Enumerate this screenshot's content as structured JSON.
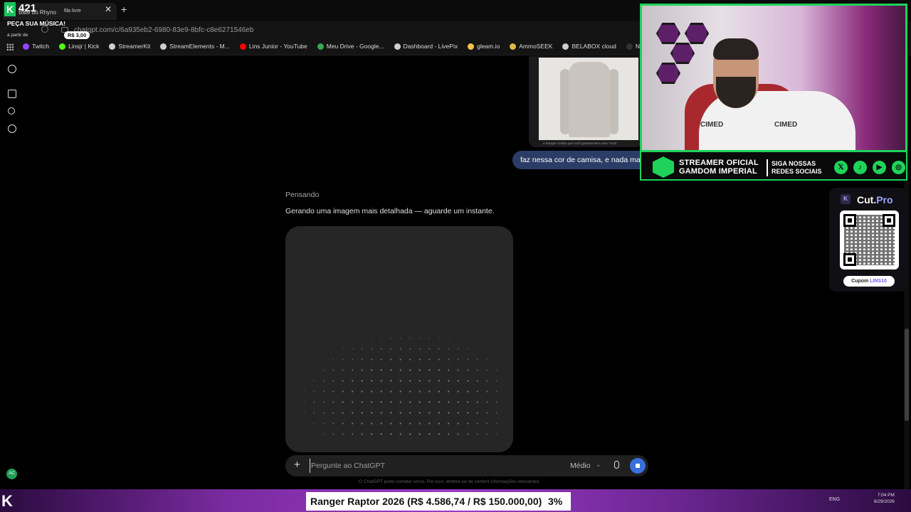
{
  "browser": {
    "tabs": [
      {
        "title": "Bate do Rhyno"
      },
      {
        "title": "fila livre"
      }
    ],
    "url": "chatgpt.com/c/6a935eb2-6980-83e9-8bfc-c8e6271546eb",
    "bookmarks": [
      {
        "label": "Twitch",
        "color": "#9146ff"
      },
      {
        "label": "Linsjr | Kick",
        "color": "#53fc18"
      },
      {
        "label": "StreamerKit",
        "color": "#cfcfcf"
      },
      {
        "label": "StreamElements - M...",
        "color": "#cfcfcf"
      },
      {
        "label": "Lins Junior - YouTube",
        "color": "#ff0000"
      },
      {
        "label": "Meu Drive - Google...",
        "color": "#34a853"
      },
      {
        "label": "Dashboard - LivePix",
        "color": "#cfcfcf"
      },
      {
        "label": "gleam.io",
        "color": "#f5c542"
      },
      {
        "label": "AmmoSEEK",
        "color": "#e0b84a"
      },
      {
        "label": "BELABOX cloud",
        "color": "#cfcfcf"
      },
      {
        "label": "Nightbot - Comm...",
        "color": "#333333"
      }
    ]
  },
  "stream_overlay": {
    "counter": "421",
    "song_request": "PEÇA SUA MÚSICA!",
    "from_label": "a partir de",
    "price": "R$ 3,00"
  },
  "chat": {
    "image_caption": "a Ranger Azulão que você gostaria bem essa \"cord\"",
    "user_message": "faz nessa cor de camisa, e nada mais",
    "status": "Pensando",
    "assistant_message": "Gerando uma imagem mais detalhada — aguarde um instante.",
    "composer": {
      "placeholder": "Pergunte ao ChatGPT",
      "model": "Médio"
    },
    "disclaimer": "O ChatGPT pode cometer erros. Por isso, lembre-se de conferir informações relevantes.",
    "avatar_initials": "AC"
  },
  "webcam": {
    "shirt_logo": "CIMED"
  },
  "banner": {
    "line1": "STREAMER OFICIAL",
    "line2": "GAMDOM IMPERIAL",
    "right1": "SIGA NOSSAS",
    "right2": "REDES SOCIAIS",
    "accent_color": "#1fd35a",
    "socials": [
      "x-icon",
      "tiktok-icon",
      "youtube-icon",
      "instagram-icon"
    ]
  },
  "sponsor": {
    "badge": "K",
    "name_main": "Cut.",
    "name_accent": "Pro",
    "coupon_label": "Cupom",
    "coupon_code": "LINS10"
  },
  "ticker": {
    "text": "Ranger Raptor 2026 (R$ 4.586,74 / R$ 150.000,00)",
    "percent": "3%"
  },
  "taskbar": {
    "language": "ENG",
    "time": "7:04 PM",
    "date": "8/29/2026"
  }
}
